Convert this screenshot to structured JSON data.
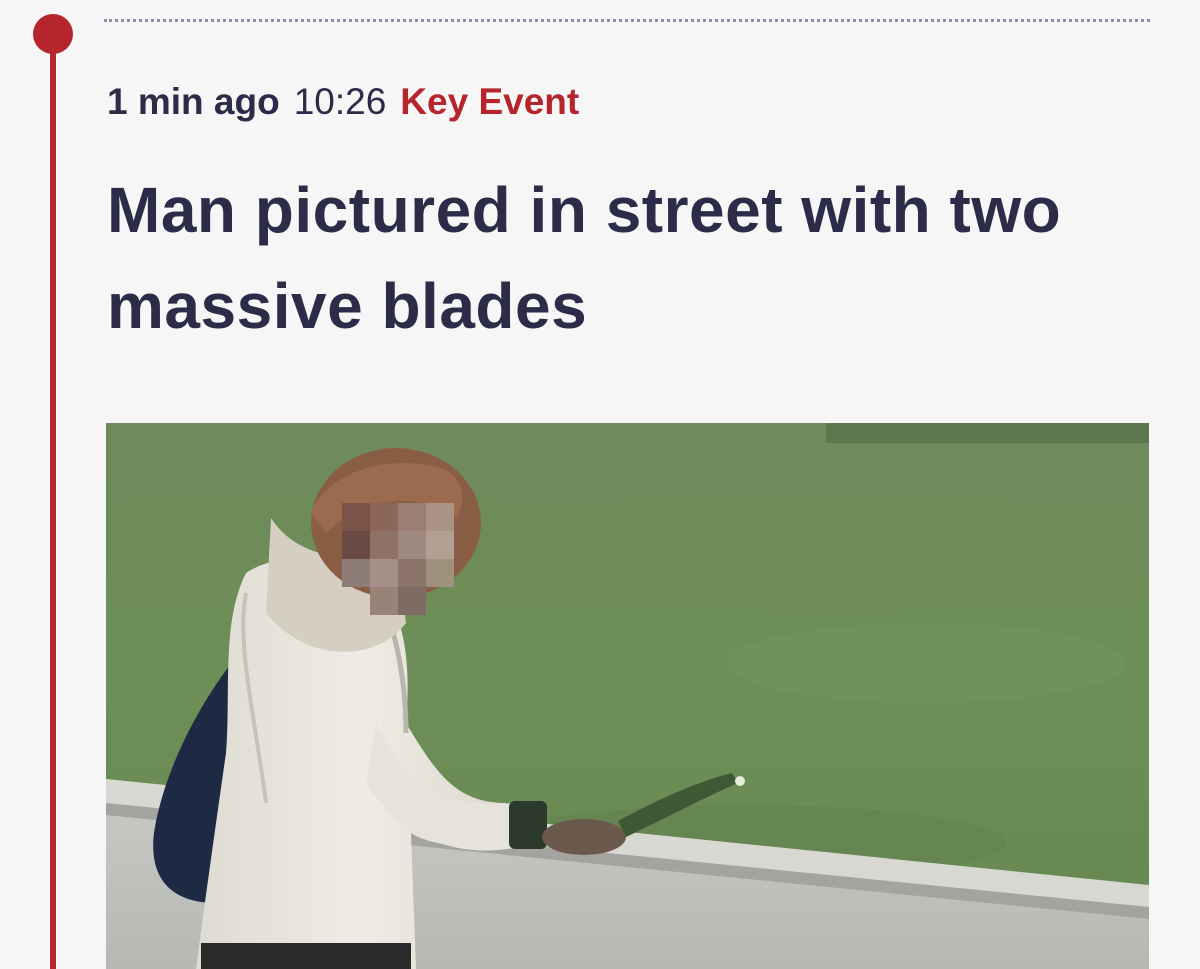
{
  "entry": {
    "relative_time": "1 min ago",
    "time": "10:26",
    "badge": "Key Event",
    "headline": "Man pictured in street with two massive blades"
  },
  "colors": {
    "accent": "#b5252b",
    "headline": "#2c2c48",
    "background": "#f5f6f5"
  },
  "icons": {
    "timeline_marker": "timeline-dot-icon"
  }
}
